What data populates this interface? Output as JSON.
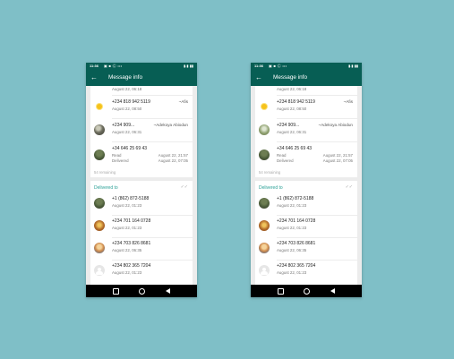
{
  "status_bar": {
    "time": "11:36",
    "icons": "▣ ■ Ⓒ •••",
    "right": "▮.▮ ▮▮"
  },
  "app_bar": {
    "back_icon": "←",
    "title": "Message info"
  },
  "read_by": {
    "first_time": "August 22, 06:18",
    "rows": [
      {
        "phone": "+234 818 942 5119",
        "name": "~Afis",
        "time": "August 22, 08:50",
        "avatar": "sun"
      },
      {
        "phone": "+234 909...",
        "name": "~Adekoya Abiodun",
        "time": "August 22, 06:31",
        "avatar": "photo"
      },
      {
        "phone": "+34 646 25 69 43",
        "read_label": "Read",
        "read_time": "August 22, 21:57",
        "delivered_label": "Delivered",
        "delivered_time": "August 22, 07:05",
        "avatar": "tree"
      }
    ],
    "remaining": "54 remaining"
  },
  "delivered_to": {
    "title": "Delivered to",
    "check_icon": "✓✓",
    "rows": [
      {
        "phone": "+1 (862) 872-5188",
        "time": "August 22, 01:23",
        "avatar": "tree"
      },
      {
        "phone": "+234 701 164 0728",
        "time": "August 22, 01:23",
        "avatar": "orange"
      },
      {
        "phone": "+234 703 826 8681",
        "time": "August 22, 06:35",
        "avatar": "sky"
      },
      {
        "phone": "+234 802 365 7204",
        "time": "August 22, 01:23",
        "avatar": "default"
      }
    ]
  }
}
